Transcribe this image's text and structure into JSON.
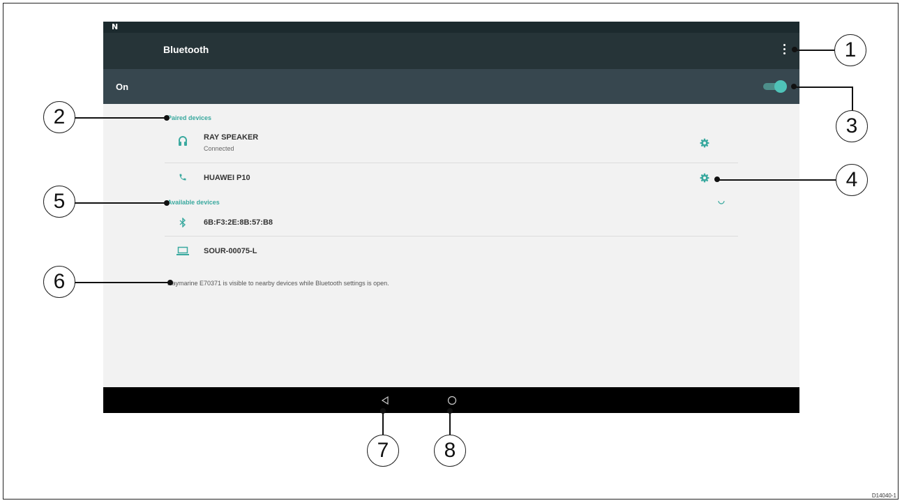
{
  "status_bar": {
    "indicator": "N"
  },
  "app_bar": {
    "title": "Bluetooth",
    "menu_icon": "more-vert-icon"
  },
  "bluetooth_toggle": {
    "label": "On",
    "state": "on"
  },
  "paired_devices": {
    "header": "Paired devices",
    "items": [
      {
        "name": "RAY SPEAKER",
        "status": "Connected",
        "icon": "headset-icon"
      },
      {
        "name": "HUAWEI P10",
        "status": "",
        "icon": "phone-icon"
      }
    ]
  },
  "available_devices": {
    "header": "Available devices",
    "items": [
      {
        "name": "6B:F3:2E:8B:57:B8",
        "icon": "bluetooth-icon"
      },
      {
        "name": "SOUR-00075-L",
        "icon": "laptop-icon"
      }
    ]
  },
  "visibility_message": "Raymarine E70371 is visible to nearby devices while Bluetooth settings is open.",
  "callouts": [
    "1",
    "2",
    "3",
    "4",
    "5",
    "6",
    "7",
    "8"
  ],
  "figure_id": "D14040-1",
  "colors": {
    "accent": "#3aa99f",
    "app_bar": "#263438",
    "toggle_bar": "#37474f"
  }
}
